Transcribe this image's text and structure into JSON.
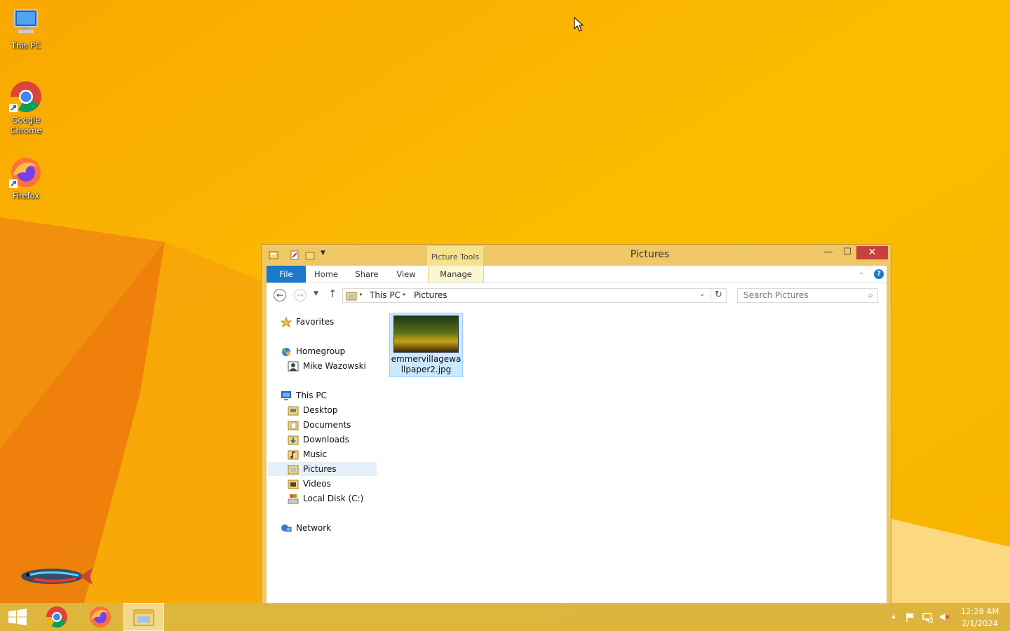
{
  "desktop": {
    "icons": [
      {
        "label": "This PC"
      },
      {
        "label": "Google Chrome"
      },
      {
        "label": "Firefox"
      }
    ]
  },
  "window": {
    "title": "Pictures",
    "context_tab_group": "Picture Tools",
    "controls": {
      "minimize": "—",
      "maximize": "☐",
      "close": "✕"
    },
    "ribbon_tabs": [
      "File",
      "Home",
      "Share",
      "View",
      "Manage"
    ],
    "address": {
      "segments": [
        "This PC",
        "Pictures"
      ]
    },
    "search": {
      "placeholder": "Search Pictures"
    },
    "nav": {
      "favorites": "Favorites",
      "homegroup": "Homegroup",
      "homegroup_user": "Mike Wazowski",
      "this_pc": "This PC",
      "this_pc_children": [
        "Desktop",
        "Documents",
        "Downloads",
        "Music",
        "Pictures",
        "Videos",
        "Local Disk (C:)"
      ],
      "network": "Network",
      "selected": "Pictures"
    },
    "files": [
      {
        "name": "emmervillagewallpaper2.jpg",
        "icon": "jpg-thumbnail"
      }
    ]
  },
  "taskbar": {
    "clock_time": "12:28 AM",
    "clock_date": "2/1/2024",
    "pinned": [
      "start-button",
      "chrome",
      "firefox",
      "file-explorer"
    ]
  },
  "colors": {
    "wallpaper": "#f7b500",
    "window_frame": "#efc767",
    "file_tab": "#1979ca",
    "close_button": "#c7413d",
    "selection": "#cce8ff"
  }
}
